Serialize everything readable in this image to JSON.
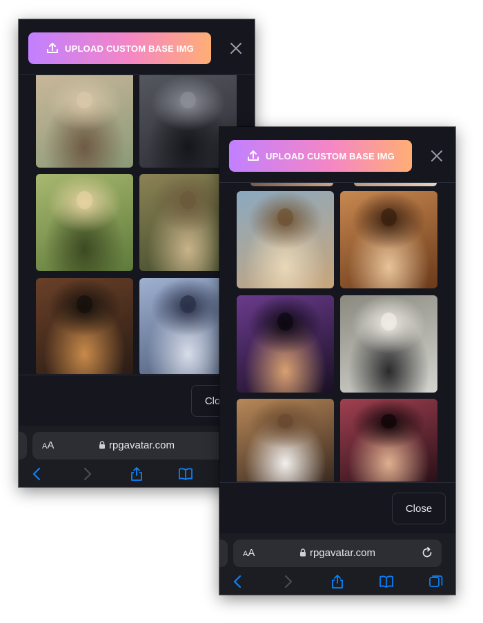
{
  "upload_label": "UPLOAD CUSTOM BASE IMG",
  "close_label": "Close",
  "url_domain": "rpgavatar.com",
  "aa_label_small": "A",
  "aa_label_big": "A",
  "accent_gradient": [
    "#c180ff",
    "#f486c6",
    "#ffae75"
  ],
  "toolbar_color": "#0a84ff",
  "left_screen": {
    "images": [
      {
        "name": "braided-warrior-photo",
        "palette": [
          "#8a9a78",
          "#c9b79a",
          "#6e5a44",
          "#d8c7a8"
        ]
      },
      {
        "name": "hooded-dark-rogue-photo",
        "palette": [
          "#2b2c33",
          "#55575f",
          "#15161b",
          "#8b8d96"
        ]
      },
      {
        "name": "elf-archer-photo",
        "palette": [
          "#5e7a3a",
          "#a8b870",
          "#3c4a22",
          "#e4d2a0"
        ]
      },
      {
        "name": "forest-elf-photo",
        "palette": [
          "#3e4a2a",
          "#8c8255",
          "#c9b38a",
          "#6c5a3c"
        ]
      },
      {
        "name": "witch-with-candle-photo",
        "palette": [
          "#2a1c14",
          "#6a4028",
          "#c88a4a",
          "#15100c"
        ]
      },
      {
        "name": "silver-armored-heroine-photo",
        "palette": [
          "#4a5a78",
          "#9fb0d0",
          "#d7dde9",
          "#2a3048"
        ]
      }
    ]
  },
  "right_screen": {
    "images": [
      {
        "name": "beach-rocks-photo",
        "palette": [
          "#c9a67a",
          "#8aa8c0",
          "#e8d7b8",
          "#6f5435"
        ]
      },
      {
        "name": "redhead-lace-photo",
        "palette": [
          "#6a3a1a",
          "#c88850",
          "#e7c39a",
          "#3a2010"
        ]
      },
      {
        "name": "nightclub-wine-photo",
        "palette": [
          "#1a1024",
          "#6a3b8c",
          "#d8a070",
          "#0c0812"
        ]
      },
      {
        "name": "business-woman-cafe-photo",
        "palette": [
          "#d5d5d0",
          "#8a8a80",
          "#2a2a2c",
          "#f0ece4"
        ]
      },
      {
        "name": "white-blazer-cafe-photo",
        "palette": [
          "#3a2a20",
          "#b88858",
          "#f2f0ee",
          "#6a4a30"
        ]
      },
      {
        "name": "party-dancer-photo",
        "palette": [
          "#2a1018",
          "#a04050",
          "#e0b090",
          "#100508"
        ]
      }
    ]
  }
}
